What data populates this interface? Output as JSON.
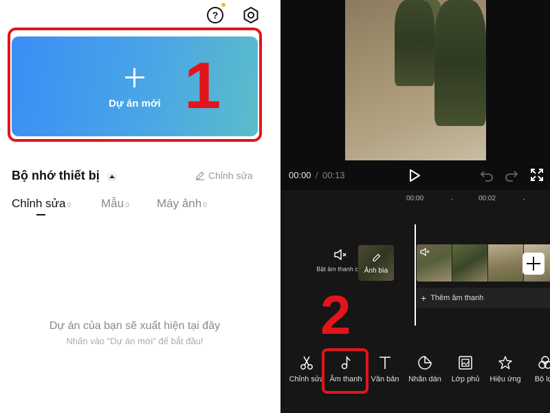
{
  "left_panel": {
    "new_project_label": "Dự án mới",
    "step_marker": "1",
    "storage_title": "Bộ nhớ thiết bị",
    "edit_link": "Chỉnh sửa",
    "tabs": [
      {
        "label": "Chỉnh sửa",
        "count": "0"
      },
      {
        "label": "Mẫu",
        "count": "0"
      },
      {
        "label": "Máy ảnh",
        "count": "0"
      }
    ],
    "empty_title": "Dự án của bạn sẽ xuất hiện tại đây",
    "empty_subtitle": "Nhấn vào \"Dự án mới\" để bắt đầu!"
  },
  "right_panel": {
    "time_current": "00:00",
    "time_separator": "/",
    "time_total": "00:13",
    "ruler": [
      "00:00",
      "00:02"
    ],
    "mute_label": "Bật âm thanh clip",
    "cover_label": "Ảnh bìa",
    "add_audio_label": "Thêm âm thanh",
    "step_marker": "2",
    "toolbar": [
      {
        "label": "Chỉnh sửa",
        "icon": "scissors-icon"
      },
      {
        "label": "Âm thanh",
        "icon": "music-note-icon"
      },
      {
        "label": "Văn bản",
        "icon": "text-icon"
      },
      {
        "label": "Nhãn dán",
        "icon": "sticker-icon"
      },
      {
        "label": "Lớp phủ",
        "icon": "overlay-icon"
      },
      {
        "label": "Hiệu ứng",
        "icon": "effect-star-icon"
      },
      {
        "label": "Bộ lọc",
        "icon": "filter-icon"
      }
    ]
  },
  "colors": {
    "highlight_red": "#e4141b",
    "card_gradient_start": "#3a8ef5",
    "card_gradient_end": "#5cbdc9",
    "dark_bg": "#0d0d0d"
  }
}
